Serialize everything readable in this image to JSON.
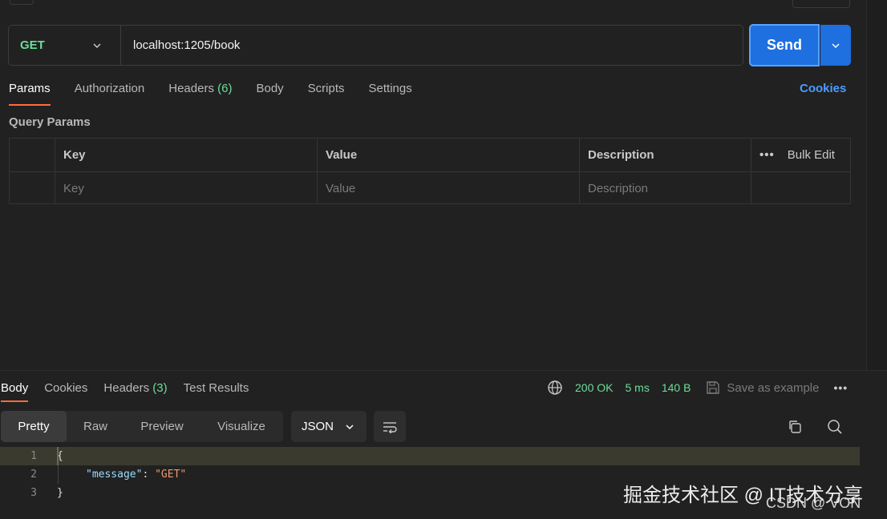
{
  "request": {
    "method": "GET",
    "url": "localhost:1205/book",
    "send_label": "Send"
  },
  "request_tabs": [
    {
      "label": "Params",
      "count": ""
    },
    {
      "label": "Authorization",
      "count": ""
    },
    {
      "label": "Headers",
      "count": "(6)"
    },
    {
      "label": "Body",
      "count": ""
    },
    {
      "label": "Scripts",
      "count": ""
    },
    {
      "label": "Settings",
      "count": ""
    }
  ],
  "cookies_label": "Cookies",
  "query_params": {
    "title": "Query Params",
    "headers": {
      "key": "Key",
      "value": "Value",
      "description": "Description"
    },
    "bulk_edit": "Bulk Edit",
    "more": "•••",
    "placeholders": {
      "key": "Key",
      "value": "Value",
      "description": "Description"
    }
  },
  "response_tabs": [
    {
      "label": "Body",
      "count": ""
    },
    {
      "label": "Cookies",
      "count": ""
    },
    {
      "label": "Headers",
      "count": "(3)"
    },
    {
      "label": "Test Results",
      "count": ""
    }
  ],
  "response_meta": {
    "status": "200 OK",
    "time": "5 ms",
    "size": "140 B",
    "save_example": "Save as example",
    "more": "•••"
  },
  "view_modes": [
    "Pretty",
    "Raw",
    "Preview",
    "Visualize"
  ],
  "format": "JSON",
  "code": {
    "line_numbers": [
      "1",
      "2",
      "3"
    ],
    "open_brace": "{",
    "key": "\"message\"",
    "colon": ": ",
    "value": "\"GET\"",
    "close_brace": "}"
  },
  "watermark": {
    "main": "掘金技术社区 @ IT技术分享",
    "sub": "CSDN @ VON"
  },
  "colors": {
    "accent_orange": "#ff6c37",
    "send_blue": "#1e6fe0",
    "method_green": "#6bdd9a",
    "link_blue": "#4d9bff"
  }
}
